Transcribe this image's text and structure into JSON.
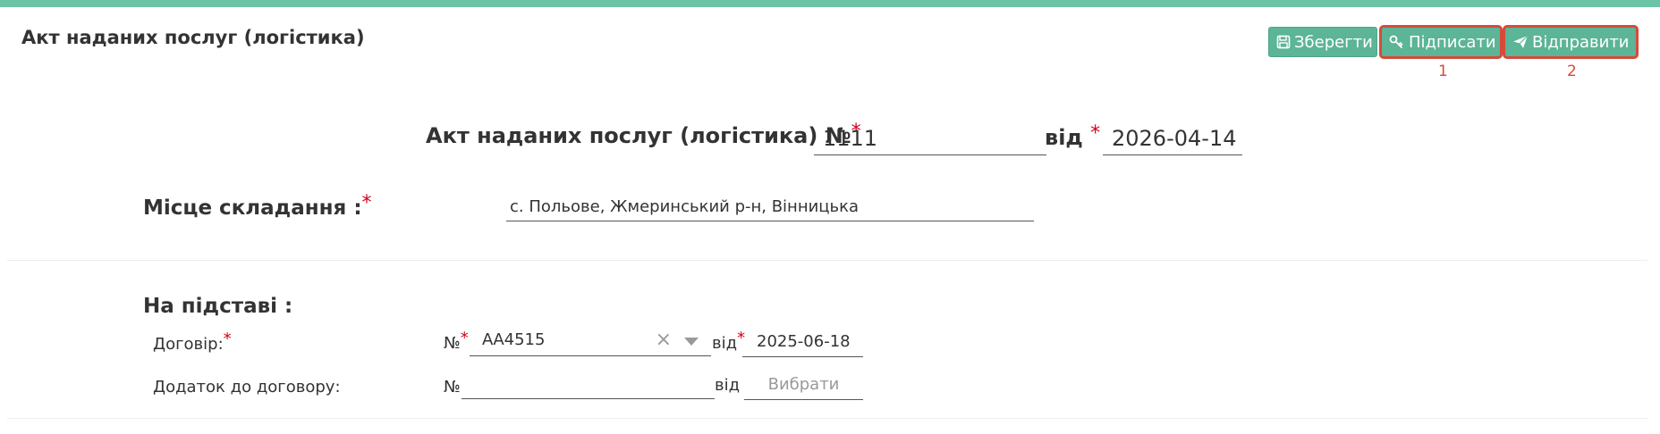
{
  "header": {
    "title": "Акт наданих послуг (логістика)"
  },
  "toolbar": {
    "save_label": "Зберегти",
    "sign_label": "Підписати",
    "send_label": "Відправити",
    "sign_marker": "1",
    "send_marker": "2"
  },
  "document": {
    "heading": "Акт наданих послуг (логістика) №",
    "number": "1111",
    "from_label": "від",
    "date": "2026-04-14"
  },
  "place": {
    "label": "Місце складання :",
    "value": "с. Польове, Жмеринський р-н, Вінницька"
  },
  "basis": {
    "label": "На підставі :",
    "contract": {
      "label": "Договір:",
      "no_label": "№",
      "number": "АА4515",
      "from_label": "від",
      "date": "2025-06-18"
    },
    "annex": {
      "label": "Додаток до договору:",
      "no_label": "№",
      "number": "",
      "from_label": "від",
      "date_placeholder": "Вибрати"
    }
  },
  "colors": {
    "accent": "#6cc4a7",
    "button": "#5bb596",
    "required": "#d0021b",
    "highlight": "#d64a3a"
  }
}
